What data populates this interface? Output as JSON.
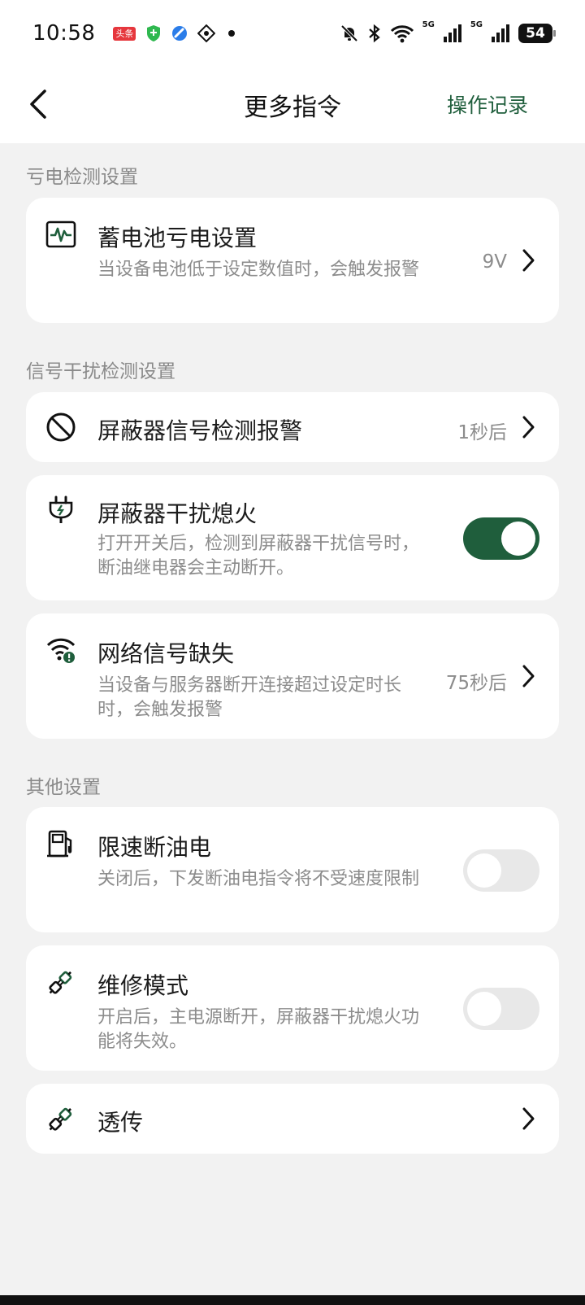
{
  "status_bar": {
    "time": "10:58",
    "app_badge": "头条",
    "net1": "5G",
    "net2": "5G",
    "battery": "54"
  },
  "navbar": {
    "title": "更多指令",
    "action": "操作记录"
  },
  "sections": {
    "battery": {
      "title": "亏电检测设置"
    },
    "signal": {
      "title": "信号干扰检测设置"
    },
    "other": {
      "title": "其他设置"
    }
  },
  "items": {
    "battery_low": {
      "title": "蓄电池亏电设置",
      "desc": "当设备电池低于设定数值时，会触发报警",
      "value": "9V"
    },
    "jammer_alarm": {
      "title": "屏蔽器信号检测报警",
      "value": "1秒后"
    },
    "jammer_shutoff": {
      "title": "屏蔽器干扰熄火",
      "desc": "打开开关后，检测到屏蔽器干扰信号时，断油继电器会主动断开。",
      "enabled": true
    },
    "network_loss": {
      "title": "网络信号缺失",
      "desc": "当设备与服务器断开连接超过设定时长时，会触发报警",
      "value": "75秒后"
    },
    "speed_limit_cut": {
      "title": "限速断油电",
      "desc": "关闭后，下发断油电指令将不受速度限制",
      "enabled": false
    },
    "maintenance_mode": {
      "title": "维修模式",
      "desc": "开启后，主电源断开，屏蔽器干扰熄火功能将失效。",
      "enabled": false
    },
    "passthrough": {
      "title": "透传"
    }
  },
  "colors": {
    "accent": "#1f5e3c",
    "background": "#f2f2f2",
    "card": "#ffffff",
    "muted_text": "#8c8c8c"
  }
}
